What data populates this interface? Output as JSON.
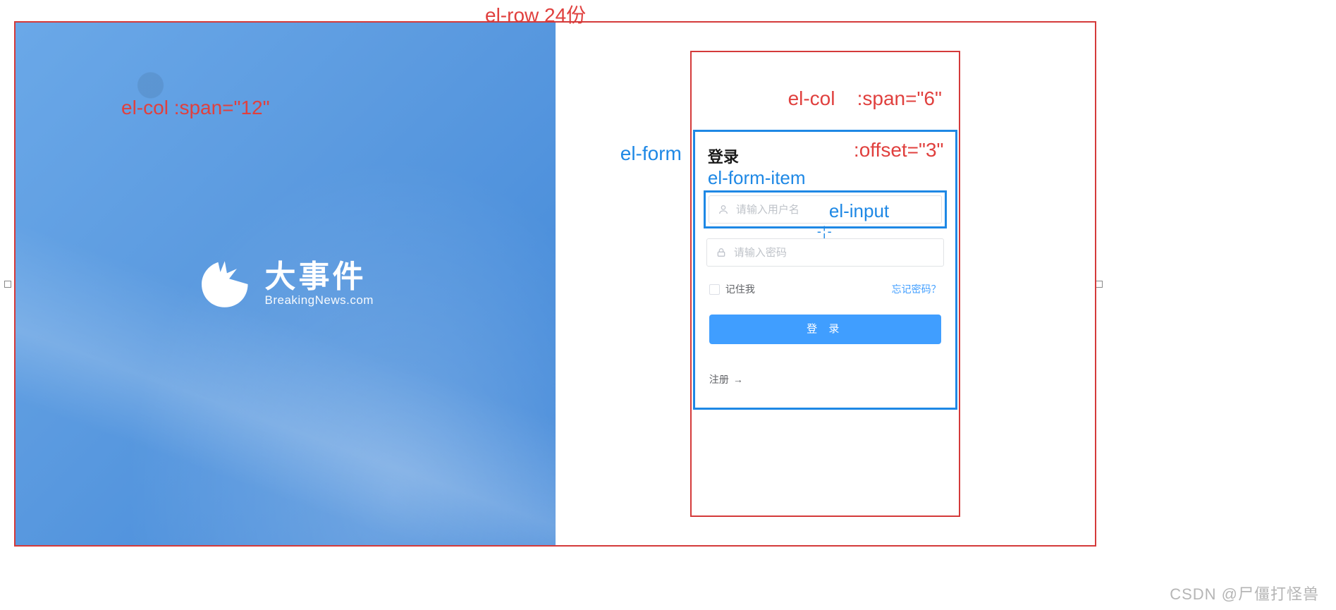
{
  "annotations": {
    "row": "el-row   24份",
    "col_left": "el-col    :span=\"12\"",
    "col_right_line1": "el-col    :span=\"6\"",
    "col_right_line2": "            :offset=\"3\"",
    "el_form": "el-form",
    "el_form_item": "el-form-item",
    "el_input": "el-input",
    "crosshair": "-¦-"
  },
  "brand": {
    "title": "大事件",
    "subtitle": "BreakingNews.com"
  },
  "form": {
    "title": "登录",
    "username_placeholder": "请输入用户名",
    "password_placeholder": "请输入密码",
    "remember": "记住我",
    "forgot": "忘记密码？",
    "login_button": "登 录",
    "register": "注册",
    "register_arrow": "→"
  },
  "watermark": "CSDN @尸僵打怪兽"
}
